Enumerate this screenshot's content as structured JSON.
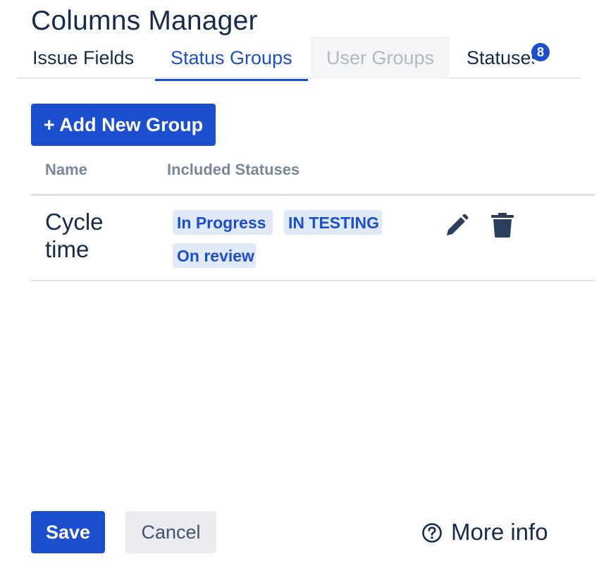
{
  "page": {
    "title": "Columns Manager"
  },
  "tabs": [
    {
      "label": "Issue Fields",
      "state": "normal"
    },
    {
      "label": "Status Groups",
      "state": "active"
    },
    {
      "label": "User Groups",
      "state": "disabled"
    },
    {
      "label": "Statuses",
      "state": "normal",
      "badge": "8"
    }
  ],
  "toolbar": {
    "add_label": "+ Add New Group"
  },
  "table": {
    "columns": [
      "Name",
      "Included Statuses"
    ],
    "rows": [
      {
        "name": "Cycle time",
        "statuses": [
          "In Progress",
          "IN TESTING",
          "On review"
        ],
        "actions": [
          "pencil-icon",
          "trash-icon"
        ]
      }
    ]
  },
  "footer": {
    "save_label": "Save",
    "cancel_label": "Cancel",
    "more_info_label": "More info",
    "more_info_icon": "question-circle-icon"
  },
  "colors": {
    "accent": "#1c4ed0",
    "text": "#172b4d",
    "muted": "#7a869a",
    "lozenge_bg": "#e0e9f8"
  }
}
